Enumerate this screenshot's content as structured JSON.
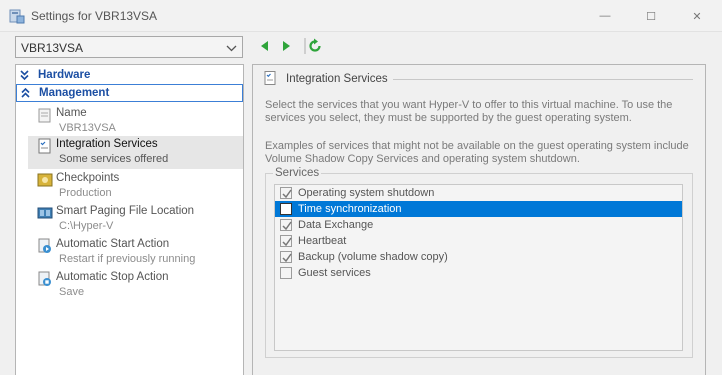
{
  "window": {
    "title": "Settings for VBR13VSA",
    "minimize_glyph": "—",
    "maximize_glyph": "☐",
    "close_glyph": "✕"
  },
  "toolbar": {
    "vm_selected": "VBR13VSA"
  },
  "sidebar": {
    "categories": [
      {
        "label": "Hardware",
        "icon": "collapsed-chevron-icon"
      },
      {
        "label": "Management",
        "icon": "expanded-chevron-icon"
      }
    ],
    "items": [
      {
        "name": "Name",
        "sub": "VBR13VSA",
        "icon": "name-icon"
      },
      {
        "name": "Integration Services",
        "sub": "Some services offered",
        "icon": "integration-services-icon"
      },
      {
        "name": "Checkpoints",
        "sub": "Production",
        "icon": "checkpoints-icon"
      },
      {
        "name": "Smart Paging File Location",
        "sub": "C:\\Hyper-V",
        "icon": "smart-paging-icon"
      },
      {
        "name": "Automatic Start Action",
        "sub": "Restart if previously running",
        "icon": "auto-start-icon"
      },
      {
        "name": "Automatic Stop Action",
        "sub": "Save",
        "icon": "auto-stop-icon"
      }
    ]
  },
  "main": {
    "section_title": "Integration Services",
    "description1": "Select the services that you want Hyper-V to offer to this virtual machine. To use the services you select, they must be supported by the guest operating system.",
    "description2": "Examples of services that might not be available on the guest operating system include Volume Shadow Copy Services and operating system shutdown.",
    "services_legend": "Services",
    "services": [
      {
        "label": "Operating system shutdown",
        "checked": true
      },
      {
        "label": "Time synchronization",
        "checked": false
      },
      {
        "label": "Data Exchange",
        "checked": true
      },
      {
        "label": "Heartbeat",
        "checked": true
      },
      {
        "label": "Backup (volume shadow copy)",
        "checked": true
      },
      {
        "label": "Guest services",
        "checked": false
      }
    ]
  },
  "colors": {
    "accent": "#0078d7",
    "category_text": "#1c4fa3",
    "nav_green": "#2ea43a"
  }
}
